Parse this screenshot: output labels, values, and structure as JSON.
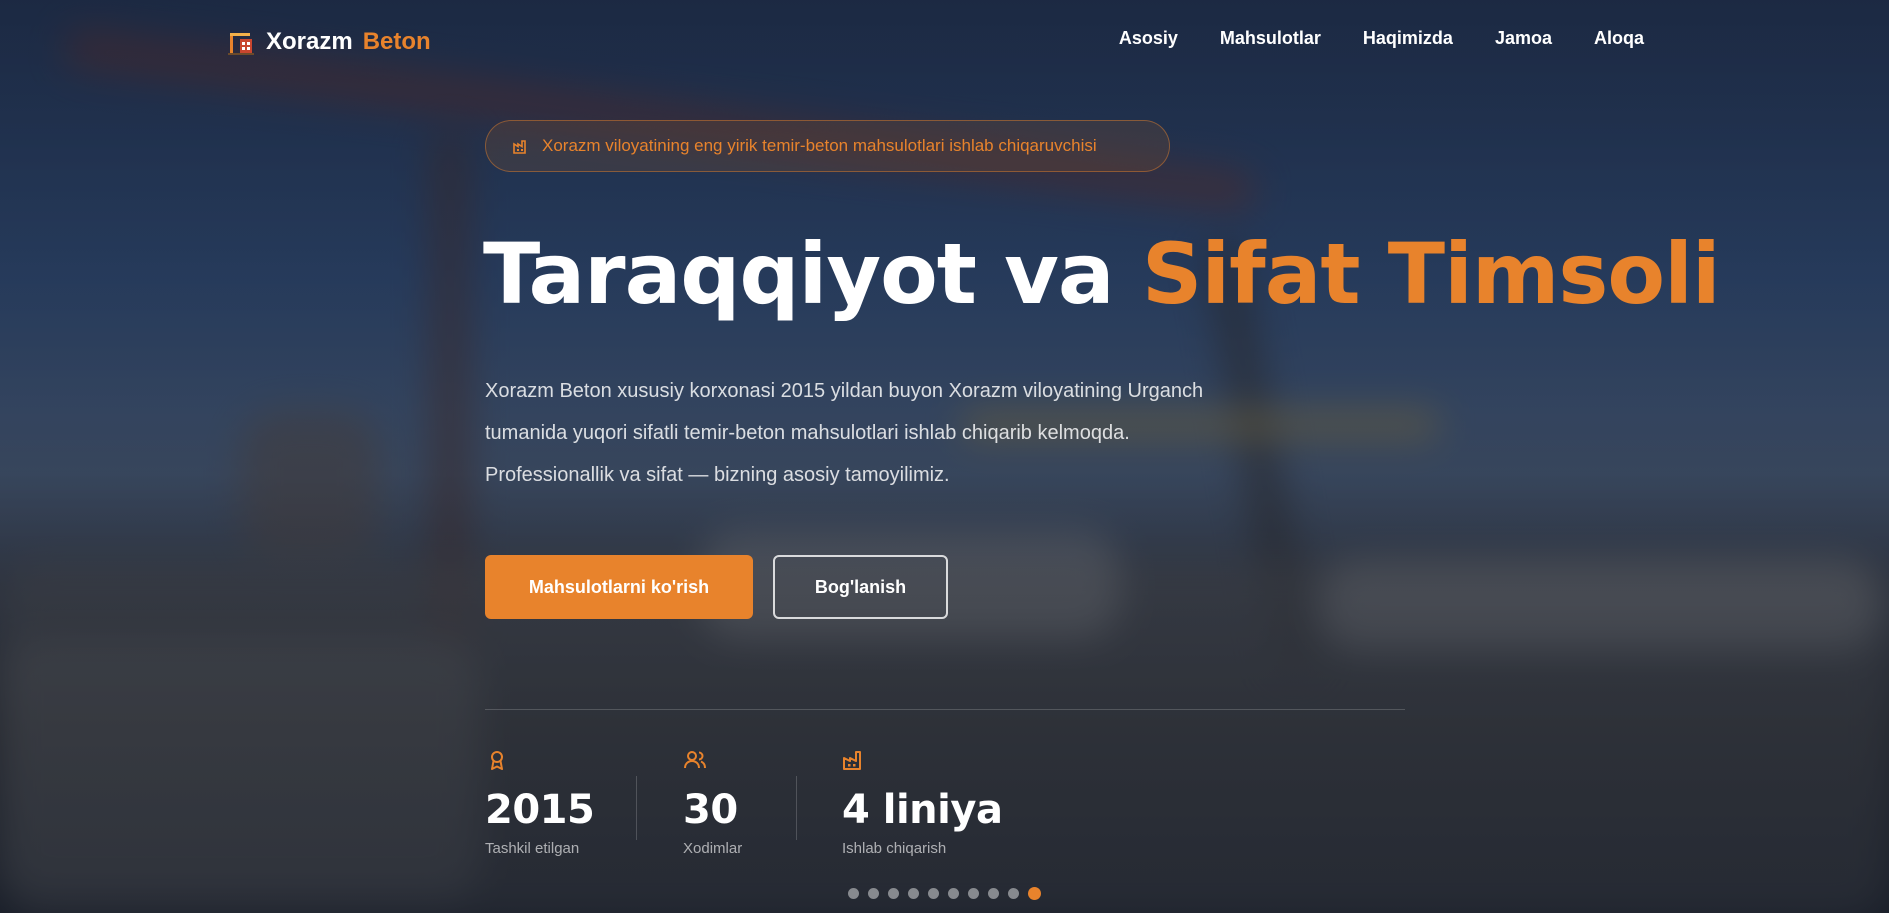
{
  "brand": {
    "name": "Xorazm",
    "accent": "Beton",
    "logo_icon": "crane-building-icon",
    "accent_color": "#e8832c"
  },
  "nav": {
    "items": [
      "Asosiy",
      "Mahsulotlar",
      "Haqimizda",
      "Jamoa",
      "Aloqa"
    ]
  },
  "hero": {
    "badge_icon": "factory-icon",
    "badge": "Xorazm viloyatining eng yirik temir-beton mahsulotlari ishlab chiqaruvchisi",
    "title_main": "Taraqqiyot va",
    "title_accent": "Sifat Timsoli",
    "description": "Xorazm Beton xususiy korxonasi 2015 yildan buyon Xorazm viloyatining Urganch tumanida yuqori sifatli temir-beton mahsulotlari ishlab chiqarib kelmoqda. Professionallik va sifat — bizning asosiy tamoyilimiz.",
    "primary_button": "Mahsulotlarni ko'rish",
    "secondary_button": "Bog'lanish"
  },
  "stats": [
    {
      "icon": "award-icon",
      "value": "2015",
      "label": "Tashkil etilgan"
    },
    {
      "icon": "users-icon",
      "value": "30",
      "label": "Xodimlar"
    },
    {
      "icon": "factory-icon",
      "value": "4 liniya",
      "label": "Ishlab chiqarish"
    }
  ],
  "carousel": {
    "total": 10,
    "active_index": 9
  }
}
